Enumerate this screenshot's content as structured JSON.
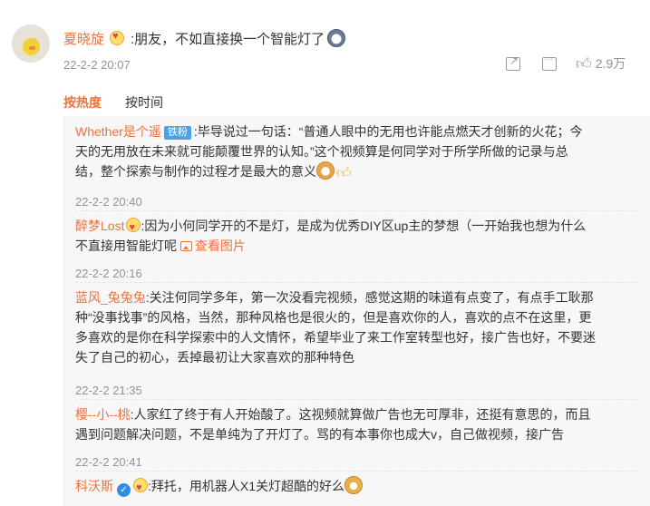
{
  "main_comment": {
    "username": "夏晓旋",
    "text": ":朋友，不如直接换一个智能灯了",
    "time": "22-2-2 20:07",
    "like_count": "2.9万",
    "icons": [
      "share-icon",
      "comment-icon",
      "like-icon"
    ]
  },
  "tabs": {
    "hot": "按热度",
    "time": "按时间"
  },
  "replies": [
    {
      "username": "Whether是个遥",
      "badge": "铁粉",
      "line1": ":毕导说过一句话：“普通人眼中的无用也许能点燃天才创新的火花；今",
      "line2": "天的无用放在未来就可能颠覆世界的认知。”这个视频算是何同学对于所学所做的记录与总",
      "line3": "结，整个探索与制作的过程才是最大的意义",
      "time": "22-2-2 20:40"
    },
    {
      "username": "醉梦Lost",
      "line1": ":因为小何同学开的不是灯，是成为优秀DIY区up主的梦想（一开始我也想为什么",
      "line2": "不直接用智能灯呢",
      "image_link": "查看图片",
      "time": "22-2-2 20:16"
    },
    {
      "username": "蓝风_兔兔兔",
      "line1": ":关注何同学多年，第一次没看完视频，感觉这期的味道有点变了，有点手工耿那",
      "line2": "种“没事找事”的风格，当然，那种风格也是很火的，但是喜欢你的人，喜欢的点不在这里，更",
      "line3": "多喜欢的是你在科学探索中的人文情怀，希望毕业了来工作室转型也好，接广告也好，不要迷",
      "line4": "失了自己的初心，丢掉最初让大家喜欢的那种特色",
      "time": "22-2-2 21:35"
    },
    {
      "username": "樱--小--桃",
      "line1": ":人家红了终于有人开始酸了。这视频就算做广告也无可厚非，还挺有意思的，而且",
      "line2": "遇到问题解决问题，不是单纯为了开灯了。骂的有本事你也成大v，自己做视频，接广告",
      "time": "22-2-2 20:41"
    },
    {
      "username": "科沃斯",
      "line1": ":拜托，用机器人X1关灯超酷的好么"
    }
  ]
}
